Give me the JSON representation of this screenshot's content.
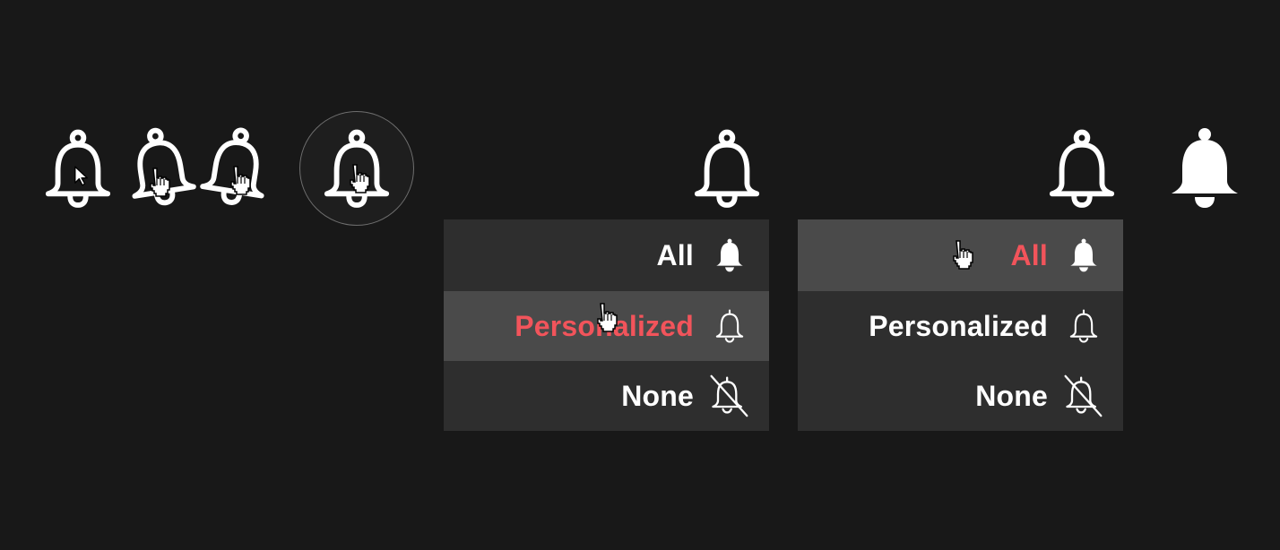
{
  "colors": {
    "background": "#181818",
    "menu_bg": "#2e2e2e",
    "menu_hover_bg": "#4a4a4a",
    "accent": "#f2545b",
    "text": "#ffffff"
  },
  "states": {
    "bell_default": {
      "icon": "bell-outline-icon",
      "cursor": "arrow-cursor-icon"
    },
    "bell_hover_tilt_left": {
      "icon": "bell-outline-icon",
      "cursor": "hand-cursor-icon"
    },
    "bell_hover_tilt_right": {
      "icon": "bell-outline-icon",
      "cursor": "hand-cursor-icon"
    },
    "bell_hover_circle": {
      "icon": "bell-outline-icon",
      "cursor": "hand-cursor-icon"
    }
  },
  "menu_personalized": {
    "items": [
      {
        "label": "All",
        "icon": "bell-filled-icon"
      },
      {
        "label": "Personalized",
        "icon": "bell-outline-icon",
        "selected": true
      },
      {
        "label": "None",
        "icon": "bell-off-icon"
      }
    ]
  },
  "menu_all": {
    "items": [
      {
        "label": "All",
        "icon": "bell-filled-icon",
        "selected": true
      },
      {
        "label": "Personalized",
        "icon": "bell-outline-icon"
      },
      {
        "label": "None",
        "icon": "bell-off-icon"
      }
    ]
  },
  "bell_filled": {
    "icon": "bell-filled-icon"
  }
}
